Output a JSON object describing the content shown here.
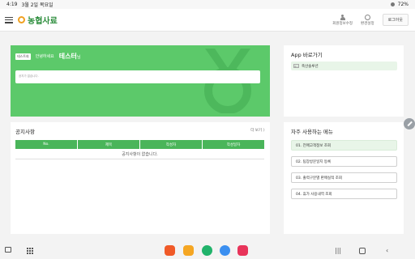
{
  "statusbar": {
    "time": "4:19",
    "date": "3월 2일 목요일",
    "battery": "72%"
  },
  "appbar": {
    "logo_text": "농협사료",
    "member_edit": "회원정보수정",
    "settings": "환경설정",
    "logout": "로그아웃"
  },
  "welcome": {
    "tag": "테스트회",
    "greeting": "안녕하세요",
    "username": "테스터",
    "suffix": "님",
    "notice_text": "공지가 없습니다."
  },
  "app_shortcut": {
    "title": "App 바로가기",
    "broken_alt": "배너",
    "link_label": "축산솔루션"
  },
  "notices": {
    "title": "공지사항",
    "more": "더 보기 〉",
    "columns": [
      "No.",
      "제목",
      "작성자",
      "작성일자"
    ],
    "empty": "공지사항이 없습니다."
  },
  "menus": {
    "title": "자주 사용하는 메뉴",
    "items": [
      "01. 전매고객정보 조회",
      "02. 팀장방문일지 등록",
      "03. 출력구분별 판매실적 조회",
      "04. 휴가 사용내역 조회"
    ]
  },
  "colors": {
    "brand_green": "#5cc96a",
    "header_green": "#4ab55a",
    "logo_orange": "#f0a020"
  }
}
